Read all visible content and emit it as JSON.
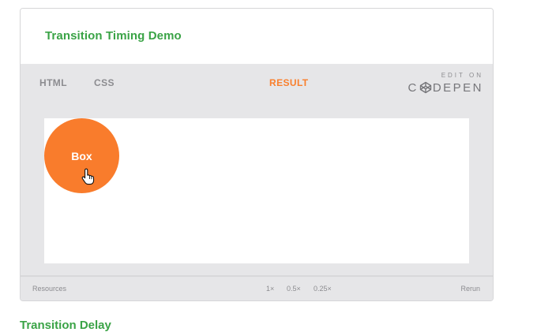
{
  "card": {
    "title": "Transition Timing Demo"
  },
  "tabs": {
    "html": "HTML",
    "css": "CSS",
    "result": "RESULT"
  },
  "codepen": {
    "edit_on": "EDIT ON",
    "logo_left": "C",
    "logo_right": "DEPEN",
    "icon": "codepen-cube-icon"
  },
  "result": {
    "box_label": "Box",
    "cursor": "hand-pointer-icon"
  },
  "footer": {
    "resources": "Resources",
    "speed_1x": "1×",
    "speed_05x": "0.5×",
    "speed_025x": "0.25×",
    "rerun": "Rerun"
  },
  "below": {
    "heading": "Transition Delay"
  },
  "colors": {
    "accent_green": "#3aa346",
    "accent_orange": "#f97c2c",
    "embed_bg": "#e6e6e8",
    "muted_text": "#8c8c90"
  }
}
